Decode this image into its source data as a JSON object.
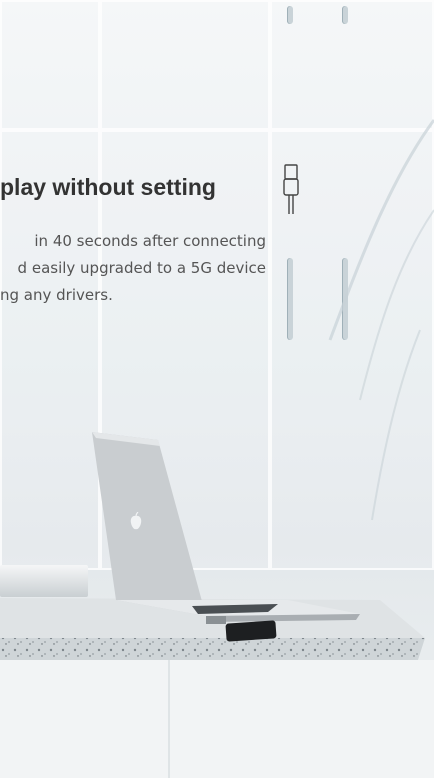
{
  "feature": {
    "headline": "play without setting",
    "lines": [
      "in 40 seconds after connecting",
      "d easily upgraded to a 5G device",
      "ng any drivers."
    ]
  },
  "icons": {
    "usb": "usb-cable-icon",
    "apple": "apple-logo-icon"
  },
  "colors": {
    "headline": "#333333",
    "body": "#555555",
    "background": "#eef2f4"
  }
}
